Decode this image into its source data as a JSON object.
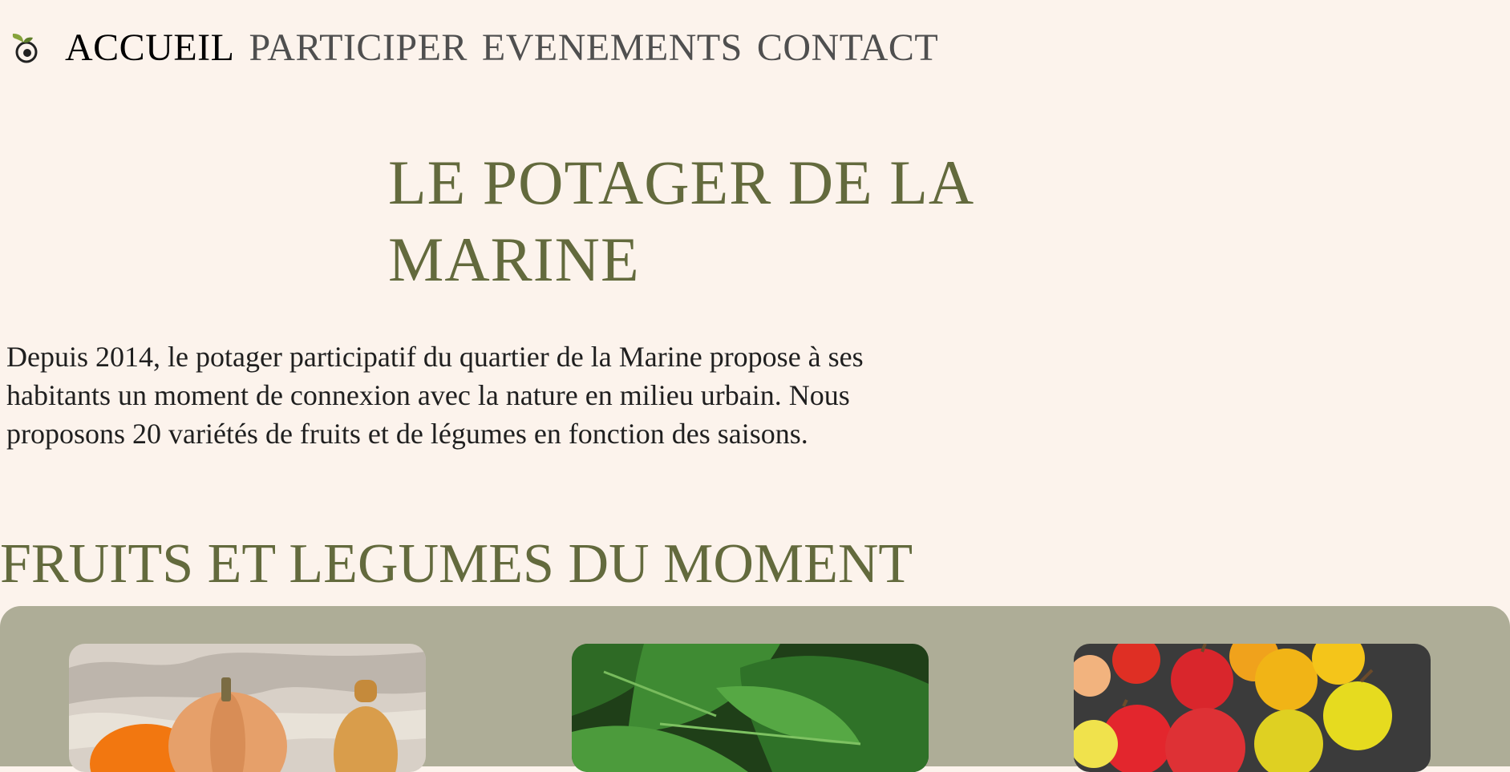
{
  "nav": {
    "logo_icon": "sprout-icon",
    "links": [
      {
        "label": "ACCUEIL",
        "active": true
      },
      {
        "label": "PARTICIPER",
        "active": false
      },
      {
        "label": "EVENEMENTS",
        "active": false
      },
      {
        "label": "CONTACT",
        "active": false
      }
    ]
  },
  "hero": {
    "title": "LE POTAGER DE LA MARINE",
    "intro": "Depuis 2014, le potager participatif du quartier de la Marine propose à ses habitants un moment de connexion avec la nature en milieu urbain. Nous proposons 20 variétés de fruits et de légumes en fonction des saisons."
  },
  "section": {
    "title": "FRUITS ET LEGUMES DU MOMENT"
  },
  "cards": [
    {
      "image": "pumpkins-image"
    },
    {
      "image": "spinach-image"
    },
    {
      "image": "apples-image"
    }
  ],
  "colors": {
    "background": "#fcf3ec",
    "accent_green": "#636a3d",
    "panel": "#aead97",
    "nav_text": "#4f4f4f",
    "nav_active": "#000000"
  }
}
